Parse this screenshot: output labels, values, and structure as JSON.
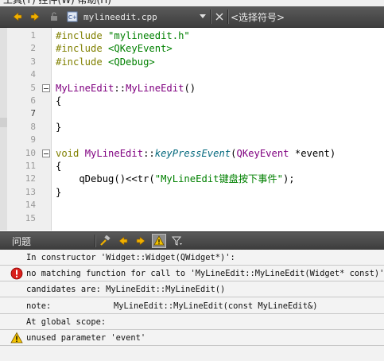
{
  "menu": {
    "clipped_text": "工具(T)    控件(W)    帮助(H)"
  },
  "toolbar": {
    "file_name": "mylineedit.cpp",
    "symbol_placeholder": "<选择符号>",
    "icons": [
      "back-arrow-icon",
      "forward-arrow-icon",
      "lock-icon",
      "cpp-file-icon",
      "dropdown-caret-icon",
      "close-file-icon"
    ]
  },
  "editor": {
    "current_line": 7,
    "lines": [
      {
        "n": "1",
        "code": [
          [
            "kw2",
            "#include "
          ],
          [
            "str",
            "\"mylineedit.h\""
          ]
        ]
      },
      {
        "n": "2",
        "code": [
          [
            "kw2",
            "#include "
          ],
          [
            "str",
            "<QKeyEvent>"
          ]
        ]
      },
      {
        "n": "3",
        "code": [
          [
            "kw2",
            "#include "
          ],
          [
            "str",
            "<QDebug>"
          ]
        ]
      },
      {
        "n": "4",
        "code": []
      },
      {
        "n": "5",
        "fold": true,
        "code": [
          [
            "cls",
            "MyLineEdit"
          ],
          [
            "op",
            "::"
          ],
          [
            "cls",
            "MyLineEdit"
          ],
          [
            "op",
            "()"
          ]
        ]
      },
      {
        "n": "6",
        "code": [
          [
            "op",
            "{"
          ]
        ]
      },
      {
        "n": "7",
        "code": []
      },
      {
        "n": "8",
        "code": [
          [
            "op",
            "}"
          ]
        ]
      },
      {
        "n": "9",
        "code": []
      },
      {
        "n": "10",
        "fold": true,
        "code": [
          [
            "kw",
            "void "
          ],
          [
            "cls",
            "MyLineEdit"
          ],
          [
            "op",
            "::"
          ],
          [
            "fn",
            "keyPressEvent"
          ],
          [
            "op",
            "("
          ],
          [
            "cls",
            "QKeyEvent"
          ],
          [
            "op",
            " *event)"
          ]
        ]
      },
      {
        "n": "11",
        "code": [
          [
            "op",
            "{"
          ]
        ]
      },
      {
        "n": "12",
        "code": [
          [
            "op",
            "    qDebug()<<tr("
          ],
          [
            "str",
            "\"MyLineEdit键盘按下事件\""
          ],
          [
            "op",
            ");"
          ]
        ]
      },
      {
        "n": "13",
        "code": [
          [
            "op",
            "}"
          ]
        ]
      },
      {
        "n": "14",
        "code": []
      },
      {
        "n": "15",
        "code": []
      }
    ]
  },
  "issues_pane": {
    "title": "问题",
    "icons": [
      "build-issues-icon",
      "prev-issue-icon",
      "next-issue-icon",
      "warning-filter-icon",
      "filter-icon"
    ],
    "items": [
      {
        "type": "none",
        "text": "In constructor 'Widget::Widget(QWidget*)':"
      },
      {
        "type": "error",
        "text": "no matching function for call to 'MyLineEdit::MyLineEdit(Widget* const)'"
      },
      {
        "type": "none",
        "text": "candidates are: MyLineEdit::MyLineEdit()"
      },
      {
        "type": "note",
        "label": "note:",
        "text": "MyLineEdit::MyLineEdit(const MyLineEdit&)"
      },
      {
        "type": "none",
        "text": "At global scope:"
      },
      {
        "type": "warning",
        "text": "unused parameter 'event'"
      }
    ]
  },
  "colors": {
    "keyword": "#808000",
    "string": "#008000",
    "type": "#800080",
    "function": "#00677c",
    "error": "#d9201c",
    "warning": "#f2c200"
  }
}
